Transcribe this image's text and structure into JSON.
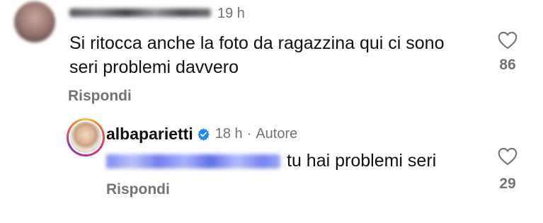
{
  "comment": {
    "time": "19 h",
    "text": "Si ritocca anche la foto da ragazzina qui ci sono seri problemi davvero",
    "reply_label": "Rispondi",
    "likes": "86"
  },
  "reply": {
    "username": "albaparietti",
    "time": "18 h",
    "separator": "·",
    "author_label": "Autore",
    "text": "tu hai problemi seri",
    "reply_label": "Rispondi",
    "likes": "29"
  },
  "colors": {
    "text_primary": "#111111",
    "text_secondary": "#737373",
    "verified_badge": "#1f8bf0",
    "mention_blur": "#7d8df0"
  },
  "icons": {
    "like": "heart-outline-icon",
    "verified": "verified-badge-icon"
  }
}
